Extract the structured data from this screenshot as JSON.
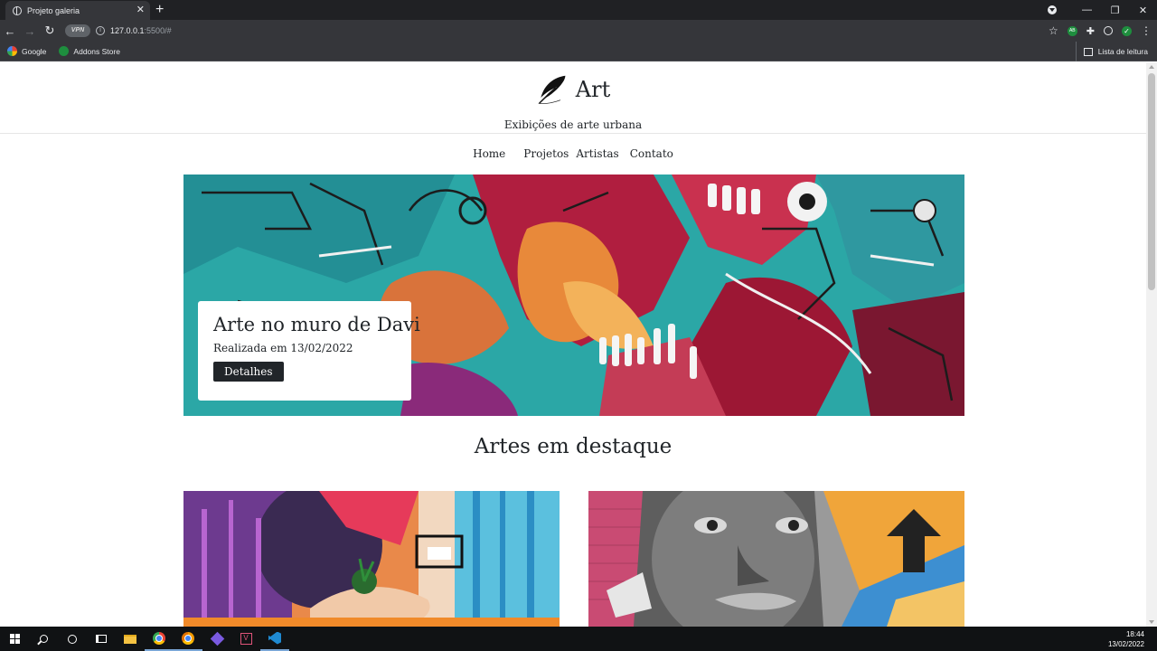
{
  "browser": {
    "tab_title": "Projeto galeria",
    "tab_close": "✕",
    "new_tab": "+",
    "url_host": "127.0.0.1",
    "url_rest": ":5500/#",
    "vpn_label": "VPN",
    "bookmarks": [
      {
        "label": "Google",
        "icon": "google-icon"
      },
      {
        "label": "Addons Store",
        "icon": "addons-store-icon"
      }
    ],
    "reading_list": "Lista de leitura",
    "window_controls": {
      "minimize": "—",
      "restore": "❐",
      "close": "✕"
    }
  },
  "site": {
    "brand": "Art",
    "subtitle": "Exibições de arte urbana",
    "nav": {
      "home": "Home",
      "projects": "Projetos",
      "artists": "Artistas",
      "contact": "Contato"
    },
    "hero": {
      "title": "Arte no muro de Davi",
      "date": "Realizada em 13/02/2022",
      "button": "Detalhes"
    },
    "section_title": "Artes em destaque"
  },
  "taskbar": {
    "time": "18:44",
    "date": "13/02/2022"
  },
  "colors": {
    "chrome_dark": "#202124",
    "chrome_toolbar": "#35363a",
    "text_dark": "#212529",
    "hero_teal": "#2ba7a6",
    "hero_crimson": "#a8173b",
    "taskbar": "#101214"
  }
}
